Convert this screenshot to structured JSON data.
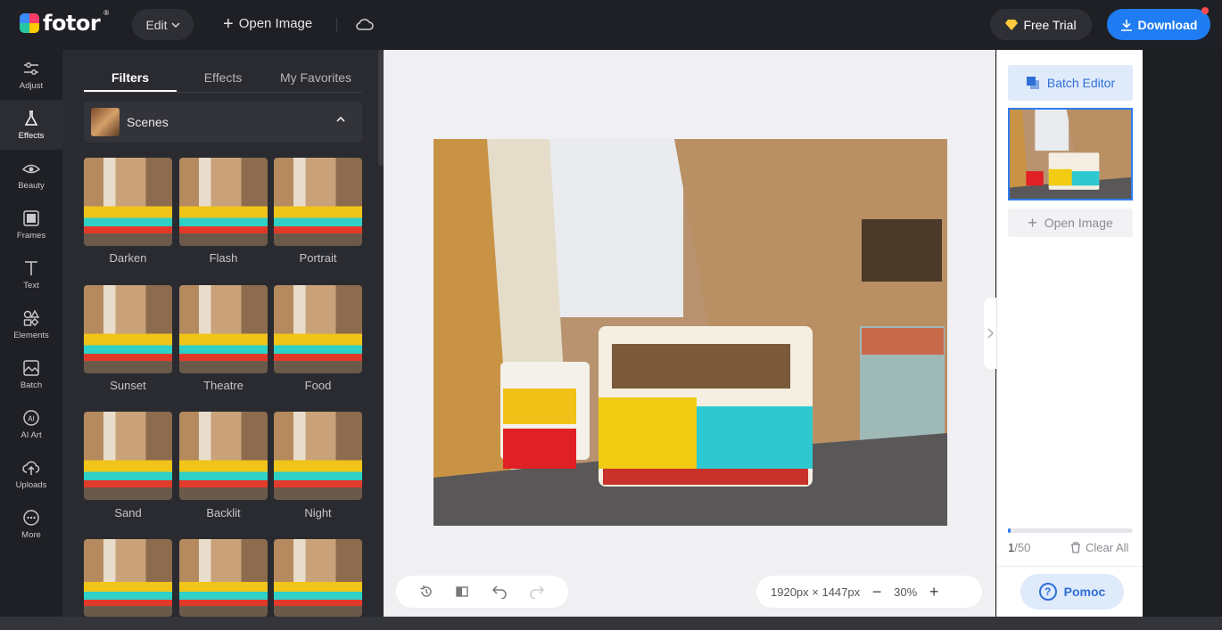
{
  "app": {
    "brand": "fotor",
    "brand_mark": "®"
  },
  "topbar": {
    "edit_label": "Edit",
    "open_image_label": "Open Image",
    "free_trial_label": "Free Trial",
    "download_label": "Download"
  },
  "leftnav": {
    "items": [
      {
        "label": "Adjust",
        "icon": "sliders-icon"
      },
      {
        "label": "Effects",
        "icon": "flask-icon",
        "active": true
      },
      {
        "label": "Beauty",
        "icon": "eye-icon"
      },
      {
        "label": "Frames",
        "icon": "frame-icon"
      },
      {
        "label": "Text",
        "icon": "text-icon"
      },
      {
        "label": "Elements",
        "icon": "shapes-icon"
      },
      {
        "label": "Batch",
        "icon": "batch-icon"
      },
      {
        "label": "AI Art",
        "icon": "ai-icon"
      },
      {
        "label": "Uploads",
        "icon": "upload-icon"
      },
      {
        "label": "More",
        "icon": "more-icon"
      }
    ]
  },
  "panel": {
    "tabs": [
      "Filters",
      "Effects",
      "My Favorites"
    ],
    "active_tab": "Filters",
    "section_title": "Scenes",
    "filters": [
      "Darken",
      "Flash",
      "Portrait",
      "Sunset",
      "Theatre",
      "Food",
      "Sand",
      "Backlit",
      "Night"
    ]
  },
  "canvas": {
    "dimensions_text": "1920px × 1447px",
    "zoom_text": "30%",
    "zoom_out": "−",
    "zoom_in": "+"
  },
  "rightpanel": {
    "batch_editor_label": "Batch Editor",
    "open_image_label": "Open Image",
    "count_current": "1",
    "count_total": "/50",
    "progress_fraction": 0.02,
    "clear_all_label": "Clear All",
    "help_label": "Pomoc",
    "help_glyph": "?"
  },
  "colors": {
    "accent": "#1f7cf2",
    "panel": "#2a2b30",
    "canvas": "#f0f0f3"
  }
}
